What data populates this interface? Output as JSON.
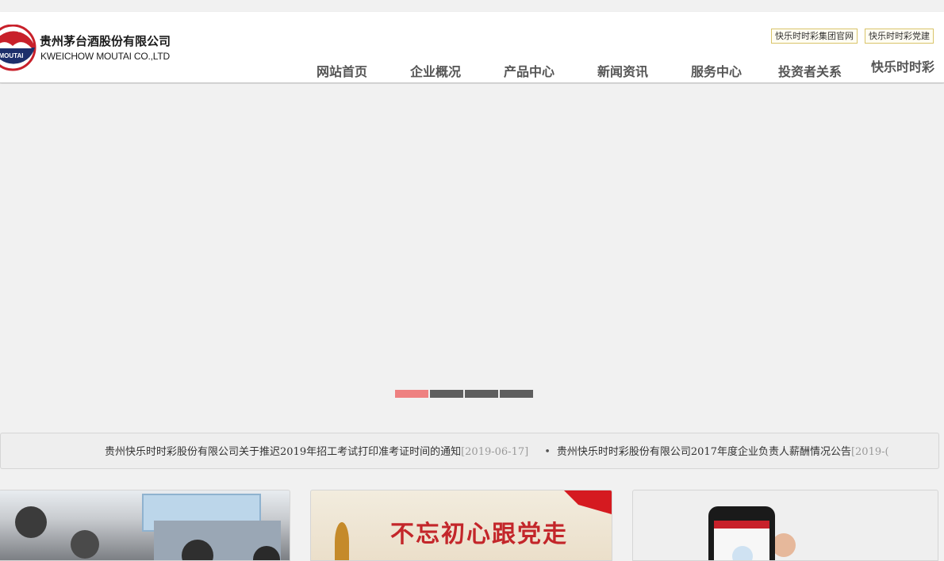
{
  "header": {
    "logo": {
      "emblem_text": "MOUTAI",
      "name_cn": "贵州茅台酒股份有限公司",
      "name_en": "KWEICHOW MOUTAI CO.,LTD"
    },
    "top_links": [
      {
        "label": "快乐时时彩集团官网"
      },
      {
        "label": "快乐时时彩党建"
      }
    ],
    "nav": [
      {
        "label": "网站首页"
      },
      {
        "label": "企业概况"
      },
      {
        "label": "产品中心"
      },
      {
        "label": "新闻资讯"
      },
      {
        "label": "服务中心"
      },
      {
        "label": "投资者关系"
      },
      {
        "label": "快乐时时彩商城"
      }
    ]
  },
  "banner": {
    "slide_count": 4,
    "active_slide": 1
  },
  "ticker": {
    "items": [
      {
        "title": "贵州快乐时时彩股份有限公司关于推迟2019年招工考试打印准考证时间的通知",
        "date": "[2019-06-17]"
      },
      {
        "bullet": "•",
        "title": "贵州快乐时时彩股份有限公司2017年度企业负责人薪酬情况公告",
        "date": "[2019-("
      }
    ]
  },
  "cards": {
    "party_title": "不忘初心跟党走"
  },
  "colors": {
    "nav_text": "#555555",
    "active_dot": "#ee8080",
    "inactive_dot": "#5e5e5e",
    "toplink_border": "#d9c46a",
    "brand_red": "#c8202a",
    "brand_blue": "#1d2f6b"
  }
}
